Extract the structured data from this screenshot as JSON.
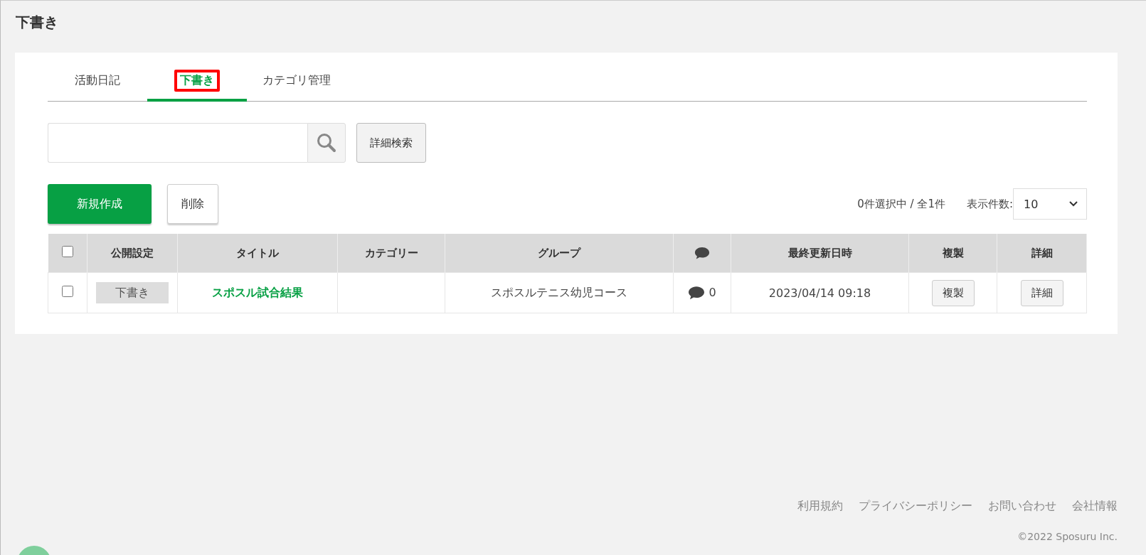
{
  "page_title": "下書き",
  "tabs": [
    {
      "label": "活動日記",
      "selected": false,
      "highlighted": false
    },
    {
      "label": "下書き",
      "selected": true,
      "highlighted": true
    },
    {
      "label": "カテゴリ管理",
      "selected": false,
      "highlighted": false
    }
  ],
  "search": {
    "button": "詳細検索"
  },
  "actions": {
    "create": "新規作成",
    "delete": "削除"
  },
  "selection_count": "0件選択中 / 全1件",
  "per_page": {
    "label": "表示件数:",
    "value": "10"
  },
  "table": {
    "columns": [
      {
        "kind": "checkbox",
        "checked": false
      },
      {
        "kind": "text",
        "label": "公開設定"
      },
      {
        "kind": "text",
        "label": "タイトル"
      },
      {
        "kind": "text",
        "label": "カテゴリー"
      },
      {
        "kind": "text",
        "label": "グループ"
      },
      {
        "kind": "comment"
      },
      {
        "kind": "text",
        "label": "最終更新日時"
      },
      {
        "kind": "text",
        "label": "複製"
      },
      {
        "kind": "text",
        "label": "詳細"
      }
    ],
    "rows": [
      {
        "checked": false,
        "status": "下書き",
        "title": "スポスル試合結果",
        "group": "スポスルテニス幼児コース",
        "comments": "0",
        "updated": "2023/04/14 09:18",
        "copy": "複製",
        "detail": "詳細"
      }
    ]
  },
  "footer": {
    "links": [
      "利用規約",
      "プライバシーポリシー",
      "お問い合わせ",
      "会社情報"
    ],
    "copyright": "©2022 Sposuru Inc."
  }
}
